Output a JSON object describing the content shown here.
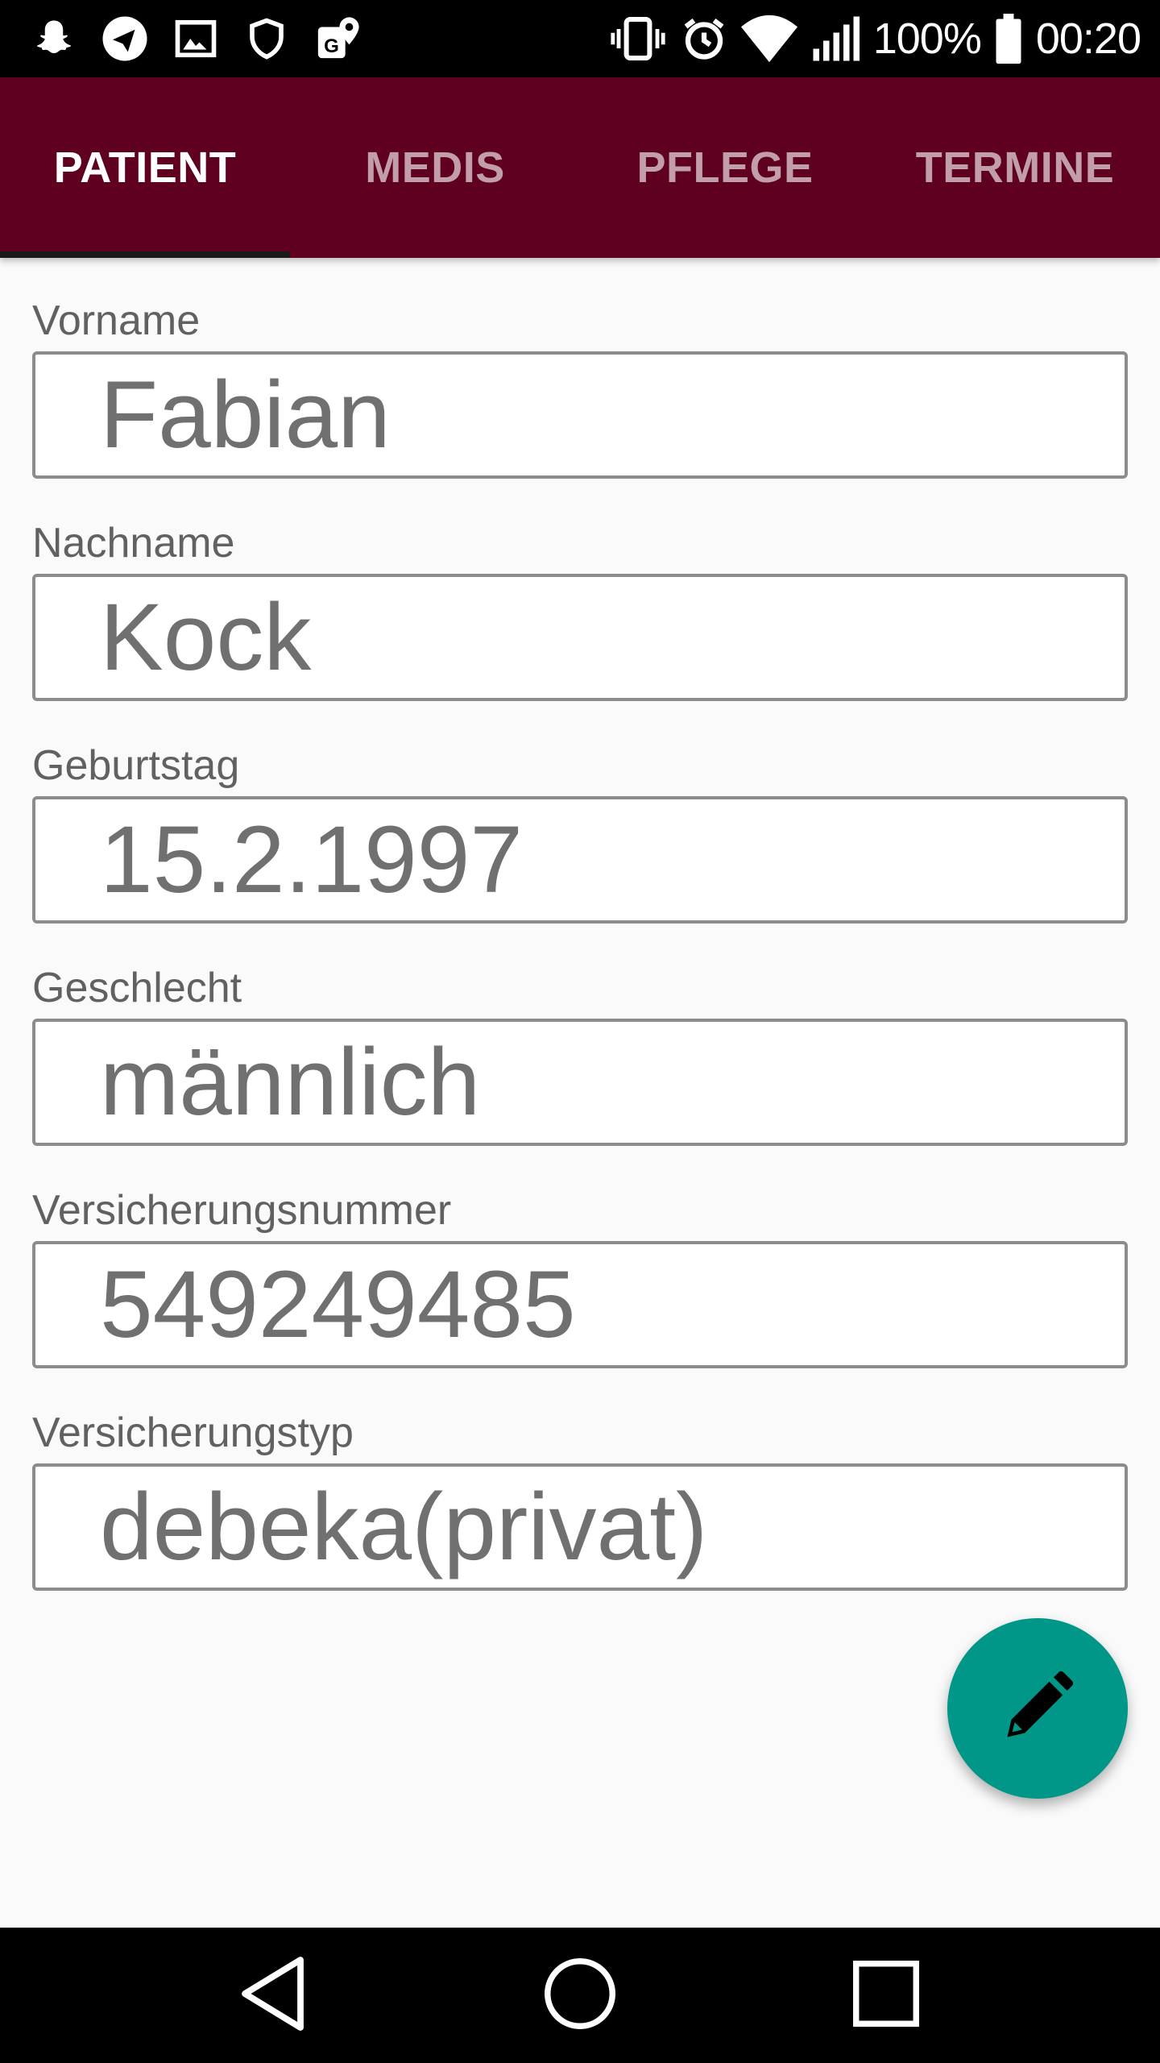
{
  "status_bar": {
    "battery_text": "100%",
    "time": "00:20",
    "left_icons": [
      "snapchat-icon",
      "telegram-icon",
      "gallery-icon",
      "shield-icon",
      "maps-icon"
    ],
    "right_icons": [
      "vibrate-icon",
      "alarm-icon",
      "wifi-icon",
      "signal-icon",
      "battery-icon"
    ]
  },
  "tabs": [
    {
      "label": "PATIENT",
      "active": true
    },
    {
      "label": "MEDIS",
      "active": false
    },
    {
      "label": "PFLEGE",
      "active": false
    },
    {
      "label": "TERMINE",
      "active": false
    }
  ],
  "form": {
    "fields": [
      {
        "label": "Vorname",
        "value": "Fabian"
      },
      {
        "label": "Nachname",
        "value": "Kock"
      },
      {
        "label": "Geburtstag",
        "value": "15.2.1997"
      },
      {
        "label": "Geschlecht",
        "value": "männlich"
      },
      {
        "label": "Versicherungsnummer",
        "value": "549249485"
      },
      {
        "label": "Versicherungstyp",
        "value": "debeka(privat)"
      }
    ]
  },
  "fab": {
    "icon": "pencil-icon"
  },
  "nav": {
    "icons": [
      "back-icon",
      "home-icon",
      "recents-icon"
    ]
  },
  "colors": {
    "app_bar": "#600020",
    "fab": "#009688",
    "background": "#fafafa"
  }
}
